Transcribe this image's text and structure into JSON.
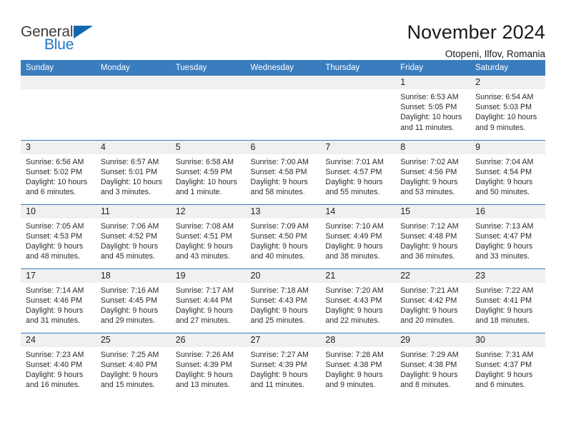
{
  "logo": {
    "text_primary": "General",
    "text_secondary": "Blue",
    "triangle_color": "#1269b0",
    "secondary_color": "#1f77c4"
  },
  "header": {
    "title": "November 2024",
    "subtitle": "Otopeni, Ilfov, Romania"
  },
  "theme": {
    "header_bg": "#3a7dbf",
    "daynum_bg": "#f0f0f0",
    "grid_line": "#3a7dbf",
    "text": "#2b2b2b"
  },
  "weekdays": [
    "Sunday",
    "Monday",
    "Tuesday",
    "Wednesday",
    "Thursday",
    "Friday",
    "Saturday"
  ],
  "weeks": [
    [
      {
        "day": "",
        "empty": true,
        "sunrise": "",
        "sunset": "",
        "daylight_line1": "",
        "daylight_line2": ""
      },
      {
        "day": "",
        "empty": true,
        "sunrise": "",
        "sunset": "",
        "daylight_line1": "",
        "daylight_line2": ""
      },
      {
        "day": "",
        "empty": true,
        "sunrise": "",
        "sunset": "",
        "daylight_line1": "",
        "daylight_line2": ""
      },
      {
        "day": "",
        "empty": true,
        "sunrise": "",
        "sunset": "",
        "daylight_line1": "",
        "daylight_line2": ""
      },
      {
        "day": "",
        "empty": true,
        "sunrise": "",
        "sunset": "",
        "daylight_line1": "",
        "daylight_line2": ""
      },
      {
        "day": "1",
        "sunrise": "Sunrise: 6:53 AM",
        "sunset": "Sunset: 5:05 PM",
        "daylight_line1": "Daylight: 10 hours",
        "daylight_line2": "and 11 minutes."
      },
      {
        "day": "2",
        "sunrise": "Sunrise: 6:54 AM",
        "sunset": "Sunset: 5:03 PM",
        "daylight_line1": "Daylight: 10 hours",
        "daylight_line2": "and 9 minutes."
      }
    ],
    [
      {
        "day": "3",
        "sunrise": "Sunrise: 6:56 AM",
        "sunset": "Sunset: 5:02 PM",
        "daylight_line1": "Daylight: 10 hours",
        "daylight_line2": "and 6 minutes."
      },
      {
        "day": "4",
        "sunrise": "Sunrise: 6:57 AM",
        "sunset": "Sunset: 5:01 PM",
        "daylight_line1": "Daylight: 10 hours",
        "daylight_line2": "and 3 minutes."
      },
      {
        "day": "5",
        "sunrise": "Sunrise: 6:58 AM",
        "sunset": "Sunset: 4:59 PM",
        "daylight_line1": "Daylight: 10 hours",
        "daylight_line2": "and 1 minute."
      },
      {
        "day": "6",
        "sunrise": "Sunrise: 7:00 AM",
        "sunset": "Sunset: 4:58 PM",
        "daylight_line1": "Daylight: 9 hours",
        "daylight_line2": "and 58 minutes."
      },
      {
        "day": "7",
        "sunrise": "Sunrise: 7:01 AM",
        "sunset": "Sunset: 4:57 PM",
        "daylight_line1": "Daylight: 9 hours",
        "daylight_line2": "and 55 minutes."
      },
      {
        "day": "8",
        "sunrise": "Sunrise: 7:02 AM",
        "sunset": "Sunset: 4:56 PM",
        "daylight_line1": "Daylight: 9 hours",
        "daylight_line2": "and 53 minutes."
      },
      {
        "day": "9",
        "sunrise": "Sunrise: 7:04 AM",
        "sunset": "Sunset: 4:54 PM",
        "daylight_line1": "Daylight: 9 hours",
        "daylight_line2": "and 50 minutes."
      }
    ],
    [
      {
        "day": "10",
        "sunrise": "Sunrise: 7:05 AM",
        "sunset": "Sunset: 4:53 PM",
        "daylight_line1": "Daylight: 9 hours",
        "daylight_line2": "and 48 minutes."
      },
      {
        "day": "11",
        "sunrise": "Sunrise: 7:06 AM",
        "sunset": "Sunset: 4:52 PM",
        "daylight_line1": "Daylight: 9 hours",
        "daylight_line2": "and 45 minutes."
      },
      {
        "day": "12",
        "sunrise": "Sunrise: 7:08 AM",
        "sunset": "Sunset: 4:51 PM",
        "daylight_line1": "Daylight: 9 hours",
        "daylight_line2": "and 43 minutes."
      },
      {
        "day": "13",
        "sunrise": "Sunrise: 7:09 AM",
        "sunset": "Sunset: 4:50 PM",
        "daylight_line1": "Daylight: 9 hours",
        "daylight_line2": "and 40 minutes."
      },
      {
        "day": "14",
        "sunrise": "Sunrise: 7:10 AM",
        "sunset": "Sunset: 4:49 PM",
        "daylight_line1": "Daylight: 9 hours",
        "daylight_line2": "and 38 minutes."
      },
      {
        "day": "15",
        "sunrise": "Sunrise: 7:12 AM",
        "sunset": "Sunset: 4:48 PM",
        "daylight_line1": "Daylight: 9 hours",
        "daylight_line2": "and 36 minutes."
      },
      {
        "day": "16",
        "sunrise": "Sunrise: 7:13 AM",
        "sunset": "Sunset: 4:47 PM",
        "daylight_line1": "Daylight: 9 hours",
        "daylight_line2": "and 33 minutes."
      }
    ],
    [
      {
        "day": "17",
        "sunrise": "Sunrise: 7:14 AM",
        "sunset": "Sunset: 4:46 PM",
        "daylight_line1": "Daylight: 9 hours",
        "daylight_line2": "and 31 minutes."
      },
      {
        "day": "18",
        "sunrise": "Sunrise: 7:16 AM",
        "sunset": "Sunset: 4:45 PM",
        "daylight_line1": "Daylight: 9 hours",
        "daylight_line2": "and 29 minutes."
      },
      {
        "day": "19",
        "sunrise": "Sunrise: 7:17 AM",
        "sunset": "Sunset: 4:44 PM",
        "daylight_line1": "Daylight: 9 hours",
        "daylight_line2": "and 27 minutes."
      },
      {
        "day": "20",
        "sunrise": "Sunrise: 7:18 AM",
        "sunset": "Sunset: 4:43 PM",
        "daylight_line1": "Daylight: 9 hours",
        "daylight_line2": "and 25 minutes."
      },
      {
        "day": "21",
        "sunrise": "Sunrise: 7:20 AM",
        "sunset": "Sunset: 4:43 PM",
        "daylight_line1": "Daylight: 9 hours",
        "daylight_line2": "and 22 minutes."
      },
      {
        "day": "22",
        "sunrise": "Sunrise: 7:21 AM",
        "sunset": "Sunset: 4:42 PM",
        "daylight_line1": "Daylight: 9 hours",
        "daylight_line2": "and 20 minutes."
      },
      {
        "day": "23",
        "sunrise": "Sunrise: 7:22 AM",
        "sunset": "Sunset: 4:41 PM",
        "daylight_line1": "Daylight: 9 hours",
        "daylight_line2": "and 18 minutes."
      }
    ],
    [
      {
        "day": "24",
        "sunrise": "Sunrise: 7:23 AM",
        "sunset": "Sunset: 4:40 PM",
        "daylight_line1": "Daylight: 9 hours",
        "daylight_line2": "and 16 minutes."
      },
      {
        "day": "25",
        "sunrise": "Sunrise: 7:25 AM",
        "sunset": "Sunset: 4:40 PM",
        "daylight_line1": "Daylight: 9 hours",
        "daylight_line2": "and 15 minutes."
      },
      {
        "day": "26",
        "sunrise": "Sunrise: 7:26 AM",
        "sunset": "Sunset: 4:39 PM",
        "daylight_line1": "Daylight: 9 hours",
        "daylight_line2": "and 13 minutes."
      },
      {
        "day": "27",
        "sunrise": "Sunrise: 7:27 AM",
        "sunset": "Sunset: 4:39 PM",
        "daylight_line1": "Daylight: 9 hours",
        "daylight_line2": "and 11 minutes."
      },
      {
        "day": "28",
        "sunrise": "Sunrise: 7:28 AM",
        "sunset": "Sunset: 4:38 PM",
        "daylight_line1": "Daylight: 9 hours",
        "daylight_line2": "and 9 minutes."
      },
      {
        "day": "29",
        "sunrise": "Sunrise: 7:29 AM",
        "sunset": "Sunset: 4:38 PM",
        "daylight_line1": "Daylight: 9 hours",
        "daylight_line2": "and 8 minutes."
      },
      {
        "day": "30",
        "sunrise": "Sunrise: 7:31 AM",
        "sunset": "Sunset: 4:37 PM",
        "daylight_line1": "Daylight: 9 hours",
        "daylight_line2": "and 6 minutes."
      }
    ]
  ]
}
